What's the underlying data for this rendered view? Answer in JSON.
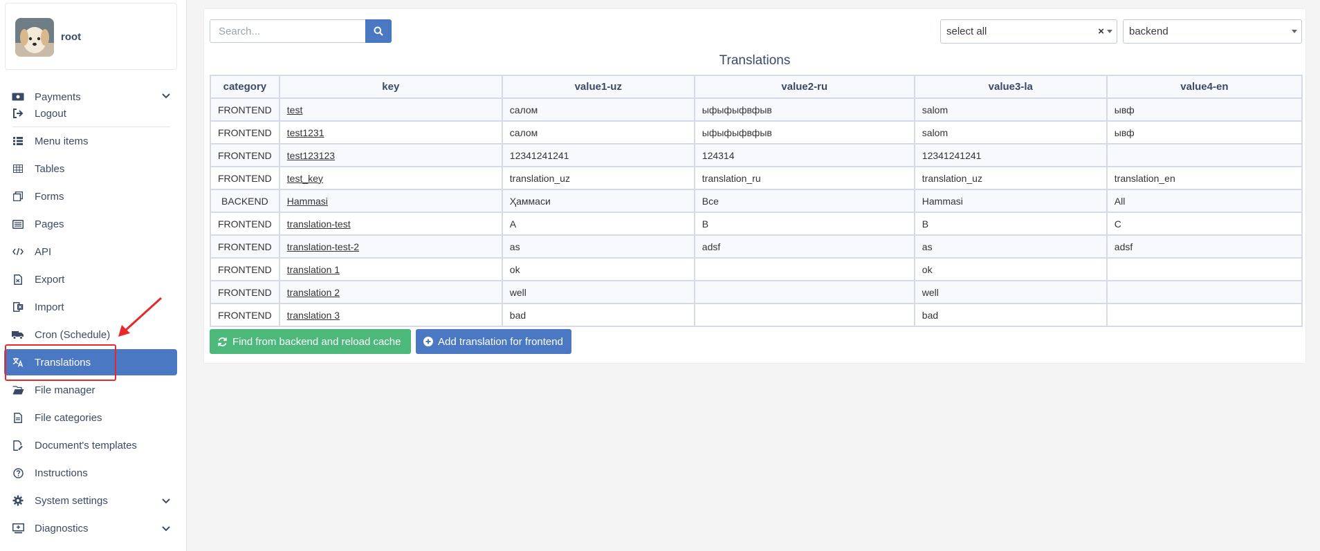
{
  "user": {
    "name": "root"
  },
  "sidebar": {
    "items": [
      {
        "label": "Payments",
        "icon": "money-icon",
        "has_chevron": true
      },
      {
        "label": "Logout",
        "icon": "logout-icon"
      },
      {
        "label": "Menu items",
        "icon": "list-icon"
      },
      {
        "label": "Tables",
        "icon": "table-icon"
      },
      {
        "label": "Forms",
        "icon": "forms-icon"
      },
      {
        "label": "Pages",
        "icon": "pages-icon"
      },
      {
        "label": "API",
        "icon": "code-icon"
      },
      {
        "label": "Export",
        "icon": "export-icon"
      },
      {
        "label": "Import",
        "icon": "import-icon"
      },
      {
        "label": "Cron (Schedule)",
        "icon": "truck-clock-icon"
      },
      {
        "label": "Translations",
        "icon": "language-icon",
        "active": true
      },
      {
        "label": "File manager",
        "icon": "folder-open-icon"
      },
      {
        "label": "File categories",
        "icon": "file-icon"
      },
      {
        "label": "Document's templates",
        "icon": "file-edit-icon"
      },
      {
        "label": "Instructions",
        "icon": "question-circle-icon"
      },
      {
        "label": "System settings",
        "icon": "gear-icon",
        "has_chevron": true
      },
      {
        "label": "Diagnostics",
        "icon": "monitor-icon",
        "has_chevron": true
      }
    ]
  },
  "search": {
    "placeholder": "Search...",
    "value": ""
  },
  "filters": {
    "all_label": "select all",
    "category_value": "backend"
  },
  "table": {
    "title": "Translations",
    "columns": [
      "category",
      "key",
      "value1-uz",
      "value2-ru",
      "value3-la",
      "value4-en"
    ],
    "rows": [
      [
        "FRONTEND",
        "test",
        "салом",
        "ыфыфыфвфыв",
        "salom",
        "ывф"
      ],
      [
        "FRONTEND",
        "test1231",
        "салом",
        "ыфыфыфвфыв",
        "salom",
        "ывф"
      ],
      [
        "FRONTEND",
        "test123123",
        "12341241241",
        "124314",
        "12341241241",
        ""
      ],
      [
        "FRONTEND",
        "test_key",
        "translation_uz",
        "translation_ru",
        "translation_uz",
        "translation_en"
      ],
      [
        "BACKEND",
        "Hammasi",
        "Ҳаммаси",
        "Все",
        "Hammasi",
        "All"
      ],
      [
        "FRONTEND",
        "translation-test",
        "A",
        "B",
        "B",
        "C"
      ],
      [
        "FRONTEND",
        "translation-test-2",
        "as",
        "adsf",
        "as",
        "adsf"
      ],
      [
        "FRONTEND",
        "translation 1",
        "ok",
        "",
        "ok",
        ""
      ],
      [
        "FRONTEND",
        "translation 2",
        "well",
        "",
        "well",
        ""
      ],
      [
        "FRONTEND",
        "translation 3",
        "bad",
        "",
        "bad",
        ""
      ]
    ]
  },
  "buttons": {
    "reload": "Find from backend and reload cache",
    "add": "Add translation for frontend"
  },
  "colors": {
    "accent": "#4a78c2",
    "success": "#4cb97a",
    "annotation": "#e8282b"
  }
}
